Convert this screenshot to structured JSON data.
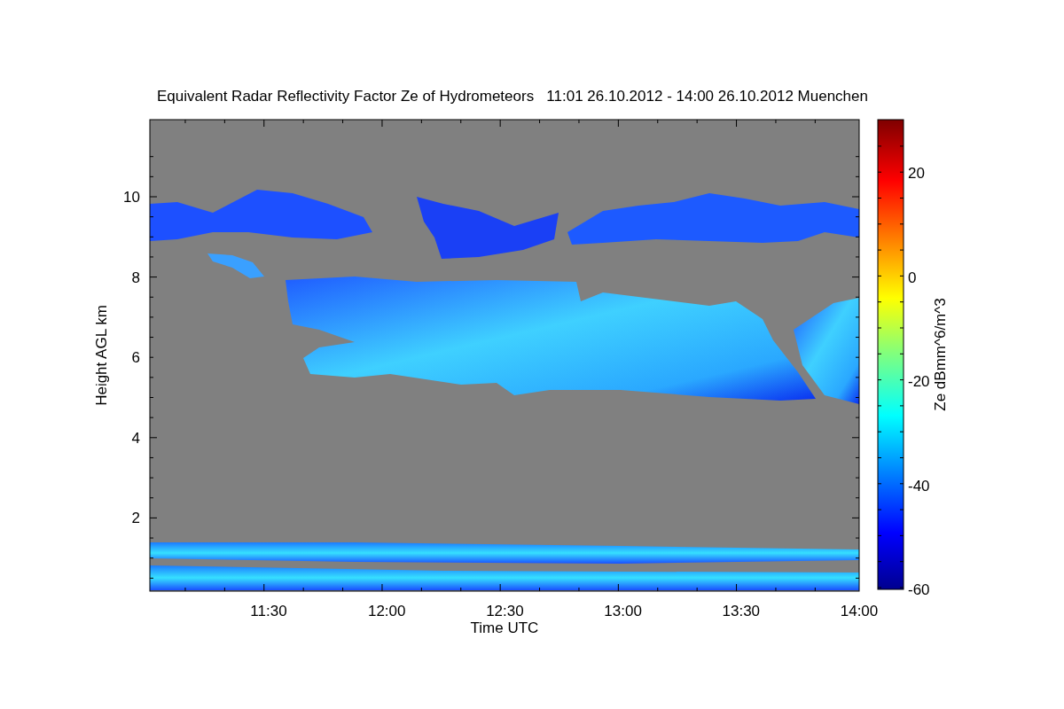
{
  "title": "Equivalent Radar Reflectivity Factor Ze of Hydrometeors   11:01 26.10.2012 - 14:00 26.10.2012 Muenchen",
  "y_axis": {
    "label": "Height AGL km",
    "ticks": [
      "10",
      "8",
      "6",
      "4",
      "2"
    ]
  },
  "x_axis": {
    "label": "Time UTC",
    "ticks": [
      "11:30",
      "12:00",
      "12:30",
      "13:00",
      "13:30",
      "14:00"
    ]
  },
  "colorbar": {
    "label": "Ze dBmm^6/m^3",
    "ticks": [
      "20",
      "0",
      "-20",
      "-40",
      "-60"
    ]
  }
}
